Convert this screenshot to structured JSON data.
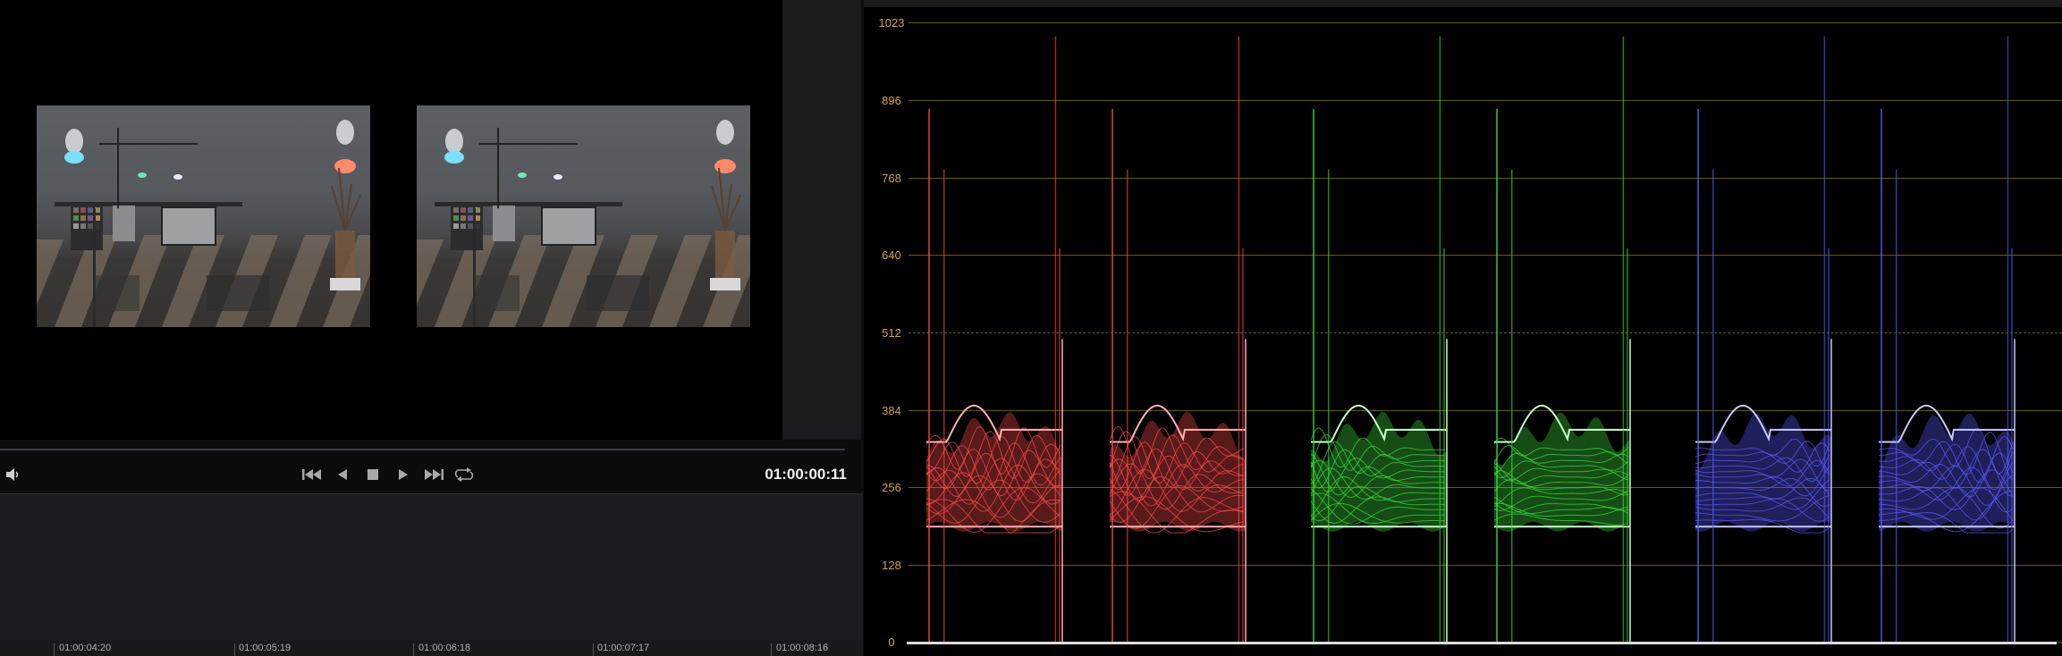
{
  "viewer": {
    "timecode": "01:00:00:11"
  },
  "transport": {
    "icons": [
      "speaker-icon",
      "skip-back-icon",
      "play-reverse-icon",
      "stop-icon",
      "play-icon",
      "skip-forward-icon",
      "loop-icon"
    ]
  },
  "timeline": {
    "ruler_labels": [
      "01:00:04:20",
      "01:00:05:19",
      "01:00:06:18",
      "01:00:07:17",
      "01:00:08:16"
    ]
  },
  "scope": {
    "scale_labels": [
      "1023",
      "896",
      "768",
      "640",
      "512",
      "384",
      "256",
      "128",
      "0"
    ],
    "colors": {
      "scale_text": "#cfa04a",
      "red": "#ff4b4b",
      "green": "#3cdc3c",
      "blue": "#5a5aff"
    }
  }
}
